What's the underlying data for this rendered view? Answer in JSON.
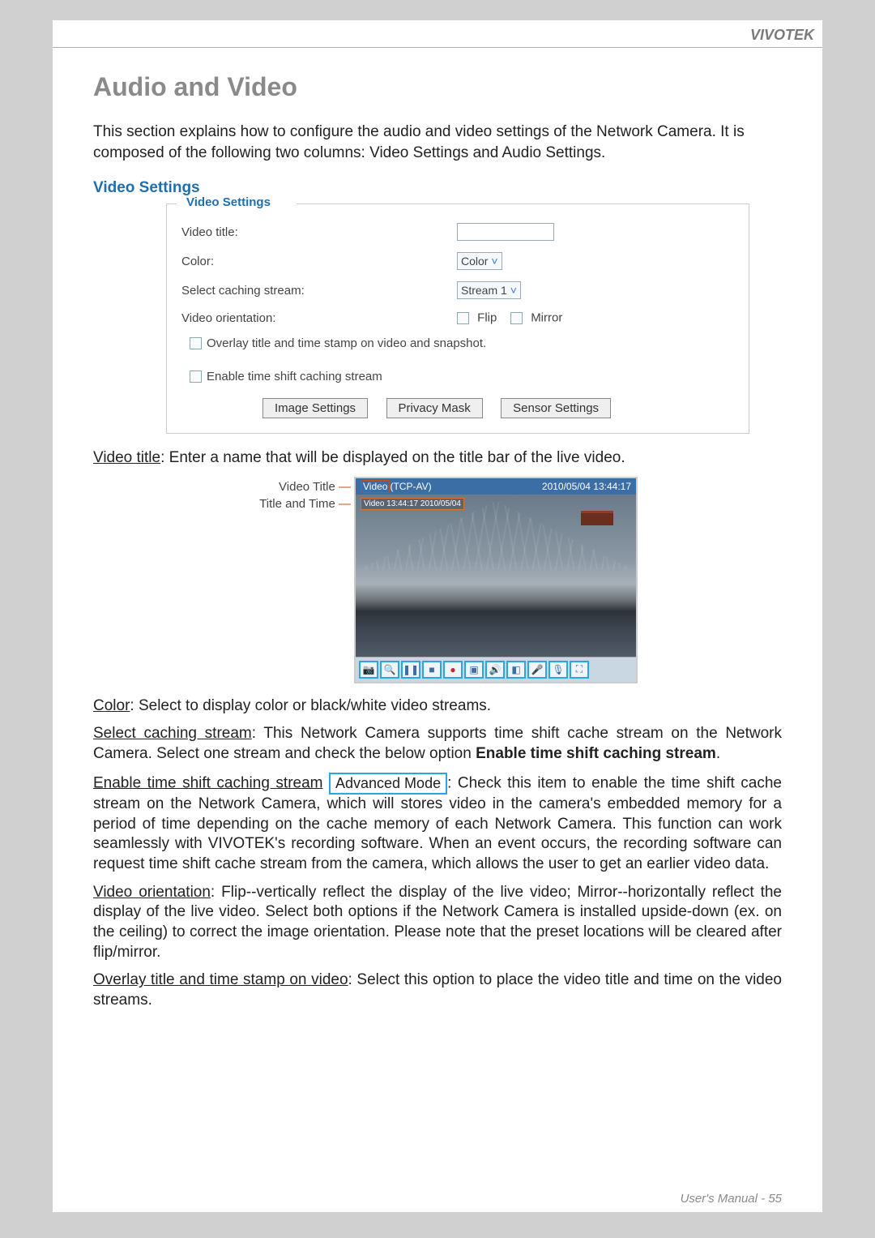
{
  "brand": "VIVOTEK",
  "section_title": "Audio and Video",
  "intro": "This section explains how to configure the audio and video settings of the Network Camera. It is composed of the following two columns: Video Settings and Audio Settings.",
  "subhead": "Video Settings",
  "fieldset": {
    "legend": "Video Settings",
    "rows": {
      "video_title_label": "Video title:",
      "video_title_value": "",
      "color_label": "Color:",
      "color_select": "Color",
      "caching_label": "Select caching stream:",
      "caching_select": "Stream 1",
      "orientation_label": "Video orientation:",
      "flip_label": "Flip",
      "mirror_label": "Mirror",
      "overlay_label": "Overlay title and time stamp on video and snapshot.",
      "timeshift_label": "Enable time shift caching stream"
    },
    "buttons": {
      "image_settings": "Image Settings",
      "privacy_mask": "Privacy Mask",
      "sensor_settings": "Sensor Settings"
    }
  },
  "figure": {
    "label_video_title": "Video Title",
    "label_title_time": "Title and Time",
    "titlebar_left_boxed": "Video",
    "titlebar_left_rest": "(TCP-AV)",
    "titlebar_right": "2010/05/04 13:44:17",
    "overlay_stamp": "Video 13:44:17  2010/05/04",
    "toolbar_icons": [
      "camera",
      "magnify",
      "pause",
      "stop",
      "record",
      "image",
      "speaker",
      "half",
      "mic-down",
      "mic",
      "expand"
    ]
  },
  "paragraphs": {
    "p_video_title_u": "Video title",
    "p_video_title_rest": ": Enter a name that will be displayed on the title bar of the live video.",
    "p_color_u": "Color",
    "p_color_rest": ": Select to display color or black/white video streams.",
    "p_caching_u": "Select caching stream",
    "p_caching_rest_1": ": This Network Camera supports time shift cache stream on the Network Camera. Select one stream and check the below option ",
    "p_caching_bold": "Enable time shift caching stream",
    "p_caching_rest_2": ".",
    "p_timeshift_u": "Enable time shift caching stream",
    "p_timeshift_badge": "Advanced Mode",
    "p_timeshift_rest": ": Check this item to enable the time shift cache stream on the Network Camera, which will stores video in the camera's embedded memory for a period of time depending on the cache memory of each Network Camera. This function can work seamlessly with VIVOTEK's recording software. When an event occurs, the recording software can request time shift cache stream from the camera, which allows the user to get an earlier video data.",
    "p_orientation_u": "Video orientation",
    "p_orientation_rest": ": Flip--vertically reflect the display of the live video; Mirror--horizontally reflect the display of the live video. Select both options if the Network Camera is installed upside-down (ex. on the ceiling) to correct the image orientation.  Please note that the preset locations will be cleared after flip/mirror.",
    "p_overlay_u": "Overlay title and time stamp on video",
    "p_overlay_rest": ": Select this option to place the video title and time on the video streams."
  },
  "footer": {
    "label": "User's Manual - ",
    "page": "55"
  }
}
